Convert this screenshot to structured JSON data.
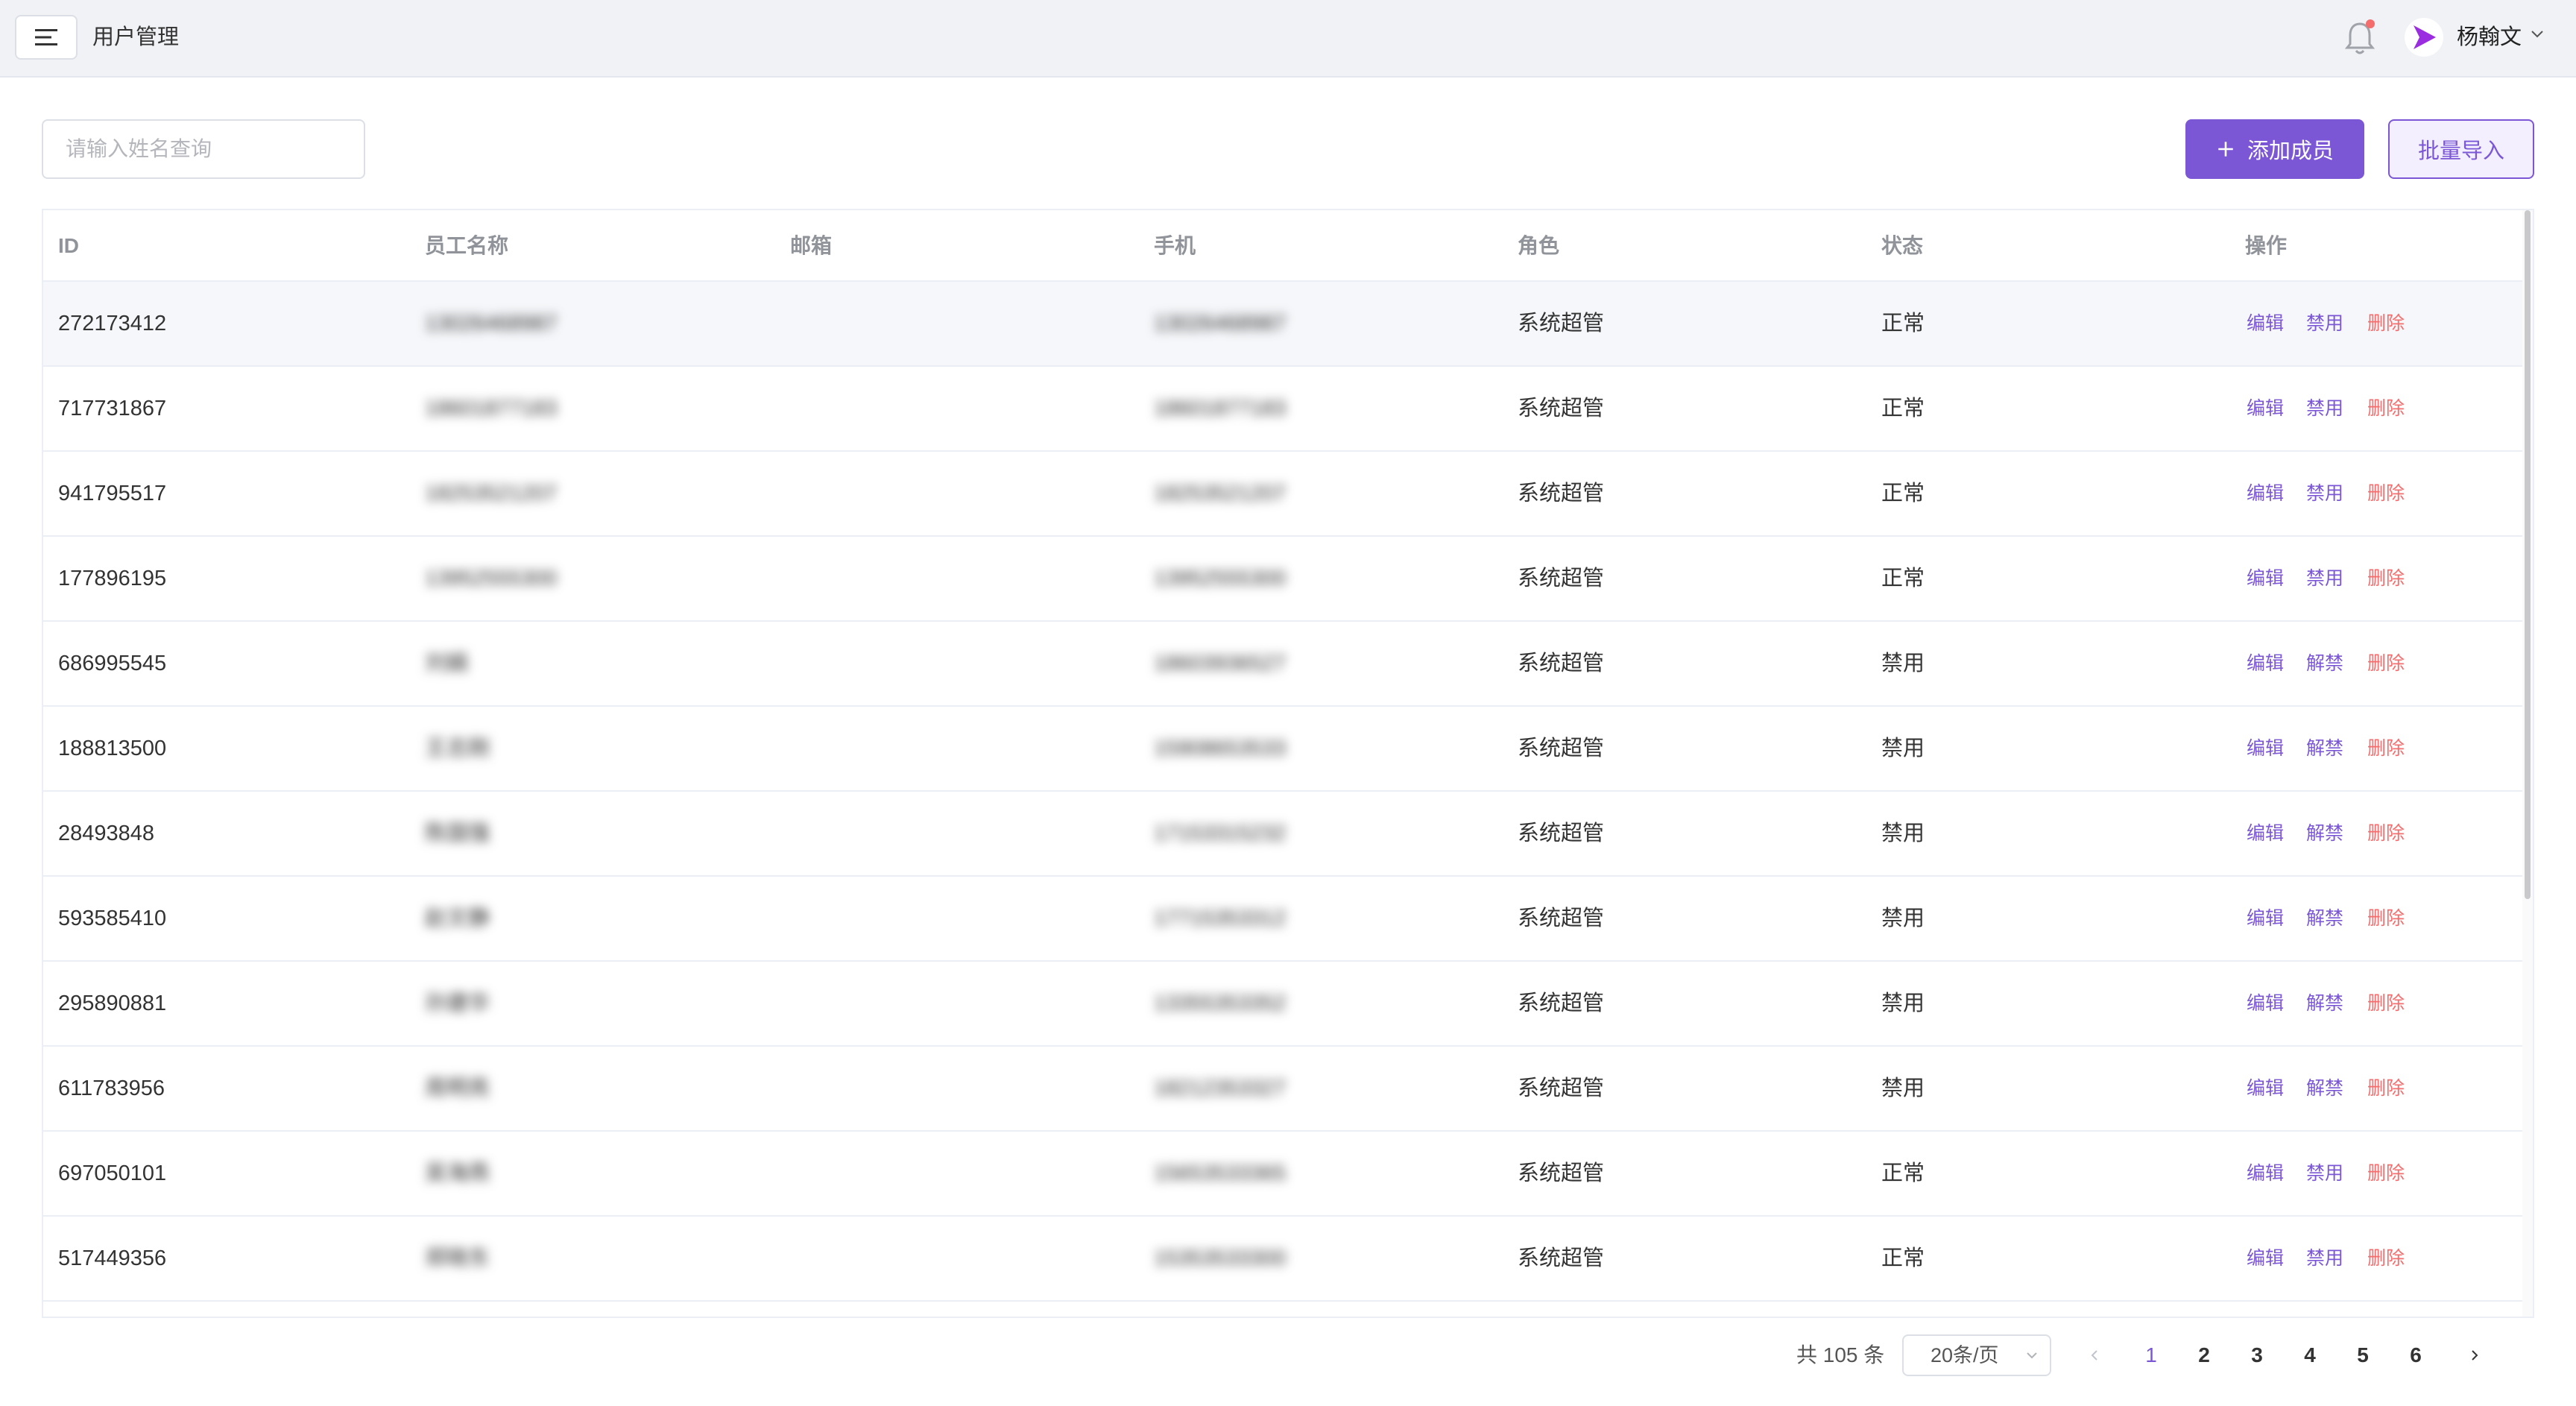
{
  "header": {
    "page_name": "用户管理",
    "user_name": "杨翰文",
    "brand_color": "#7b57d6"
  },
  "toolbar": {
    "search_placeholder": "请输入姓名查询",
    "add_label": "添加成员",
    "import_label": "批量导入"
  },
  "table": {
    "columns": [
      "ID",
      "员工名称",
      "邮箱",
      "手机",
      "角色",
      "状态",
      "操作"
    ],
    "rows": [
      {
        "id": "272173412",
        "name": "13026468987",
        "email": "",
        "phone": "13026468987",
        "role": "系统超管",
        "status": "正常",
        "toggle": "禁用"
      },
      {
        "id": "717731867",
        "name": "18601877183",
        "email": "",
        "phone": "18601877183",
        "role": "系统超管",
        "status": "正常",
        "toggle": "禁用"
      },
      {
        "id": "941795517",
        "name": "18253521207",
        "email": "",
        "phone": "18253521207",
        "role": "系统超管",
        "status": "正常",
        "toggle": "禁用"
      },
      {
        "id": "177896195",
        "name": "13952555300",
        "email": "",
        "phone": "13952555300",
        "role": "系统超管",
        "status": "正常",
        "toggle": "禁用"
      },
      {
        "id": "686995545",
        "name": "刘娟",
        "email": "",
        "phone": "18603936527",
        "role": "系统超管",
        "status": "禁用",
        "toggle": "解禁"
      },
      {
        "id": "188813500",
        "name": "王志刚",
        "email": "",
        "phone": "15908653533",
        "role": "系统超管",
        "status": "禁用",
        "toggle": "解禁"
      },
      {
        "id": "28493848",
        "name": "陈国强",
        "email": "",
        "phone": "17153315232",
        "role": "系统超管",
        "status": "禁用",
        "toggle": "解禁"
      },
      {
        "id": "593585410",
        "name": "赵文静",
        "email": "",
        "phone": "17715353312",
        "role": "系统超管",
        "status": "禁用",
        "toggle": "解禁"
      },
      {
        "id": "295890881",
        "name": "孙建华",
        "email": "",
        "phone": "13355353352",
        "role": "系统超管",
        "status": "禁用",
        "toggle": "解禁"
      },
      {
        "id": "611783956",
        "name": "周明亮",
        "email": "",
        "phone": "18212353327",
        "role": "系统超管",
        "status": "禁用",
        "toggle": "解禁"
      },
      {
        "id": "697050101",
        "name": "吴海燕",
        "email": "",
        "phone": "15653533365",
        "role": "系统超管",
        "status": "正常",
        "toggle": "禁用"
      },
      {
        "id": "517449356",
        "name": "郑晓东",
        "email": "",
        "phone": "15353533300",
        "role": "系统超管",
        "status": "正常",
        "toggle": "禁用"
      }
    ],
    "edit_label": "编辑",
    "delete_label": "删除"
  },
  "pagination": {
    "total_text": "共 105 条",
    "page_size": "20条/页",
    "pages": [
      "1",
      "2",
      "3",
      "4",
      "5",
      "6"
    ],
    "current_page": "1"
  }
}
